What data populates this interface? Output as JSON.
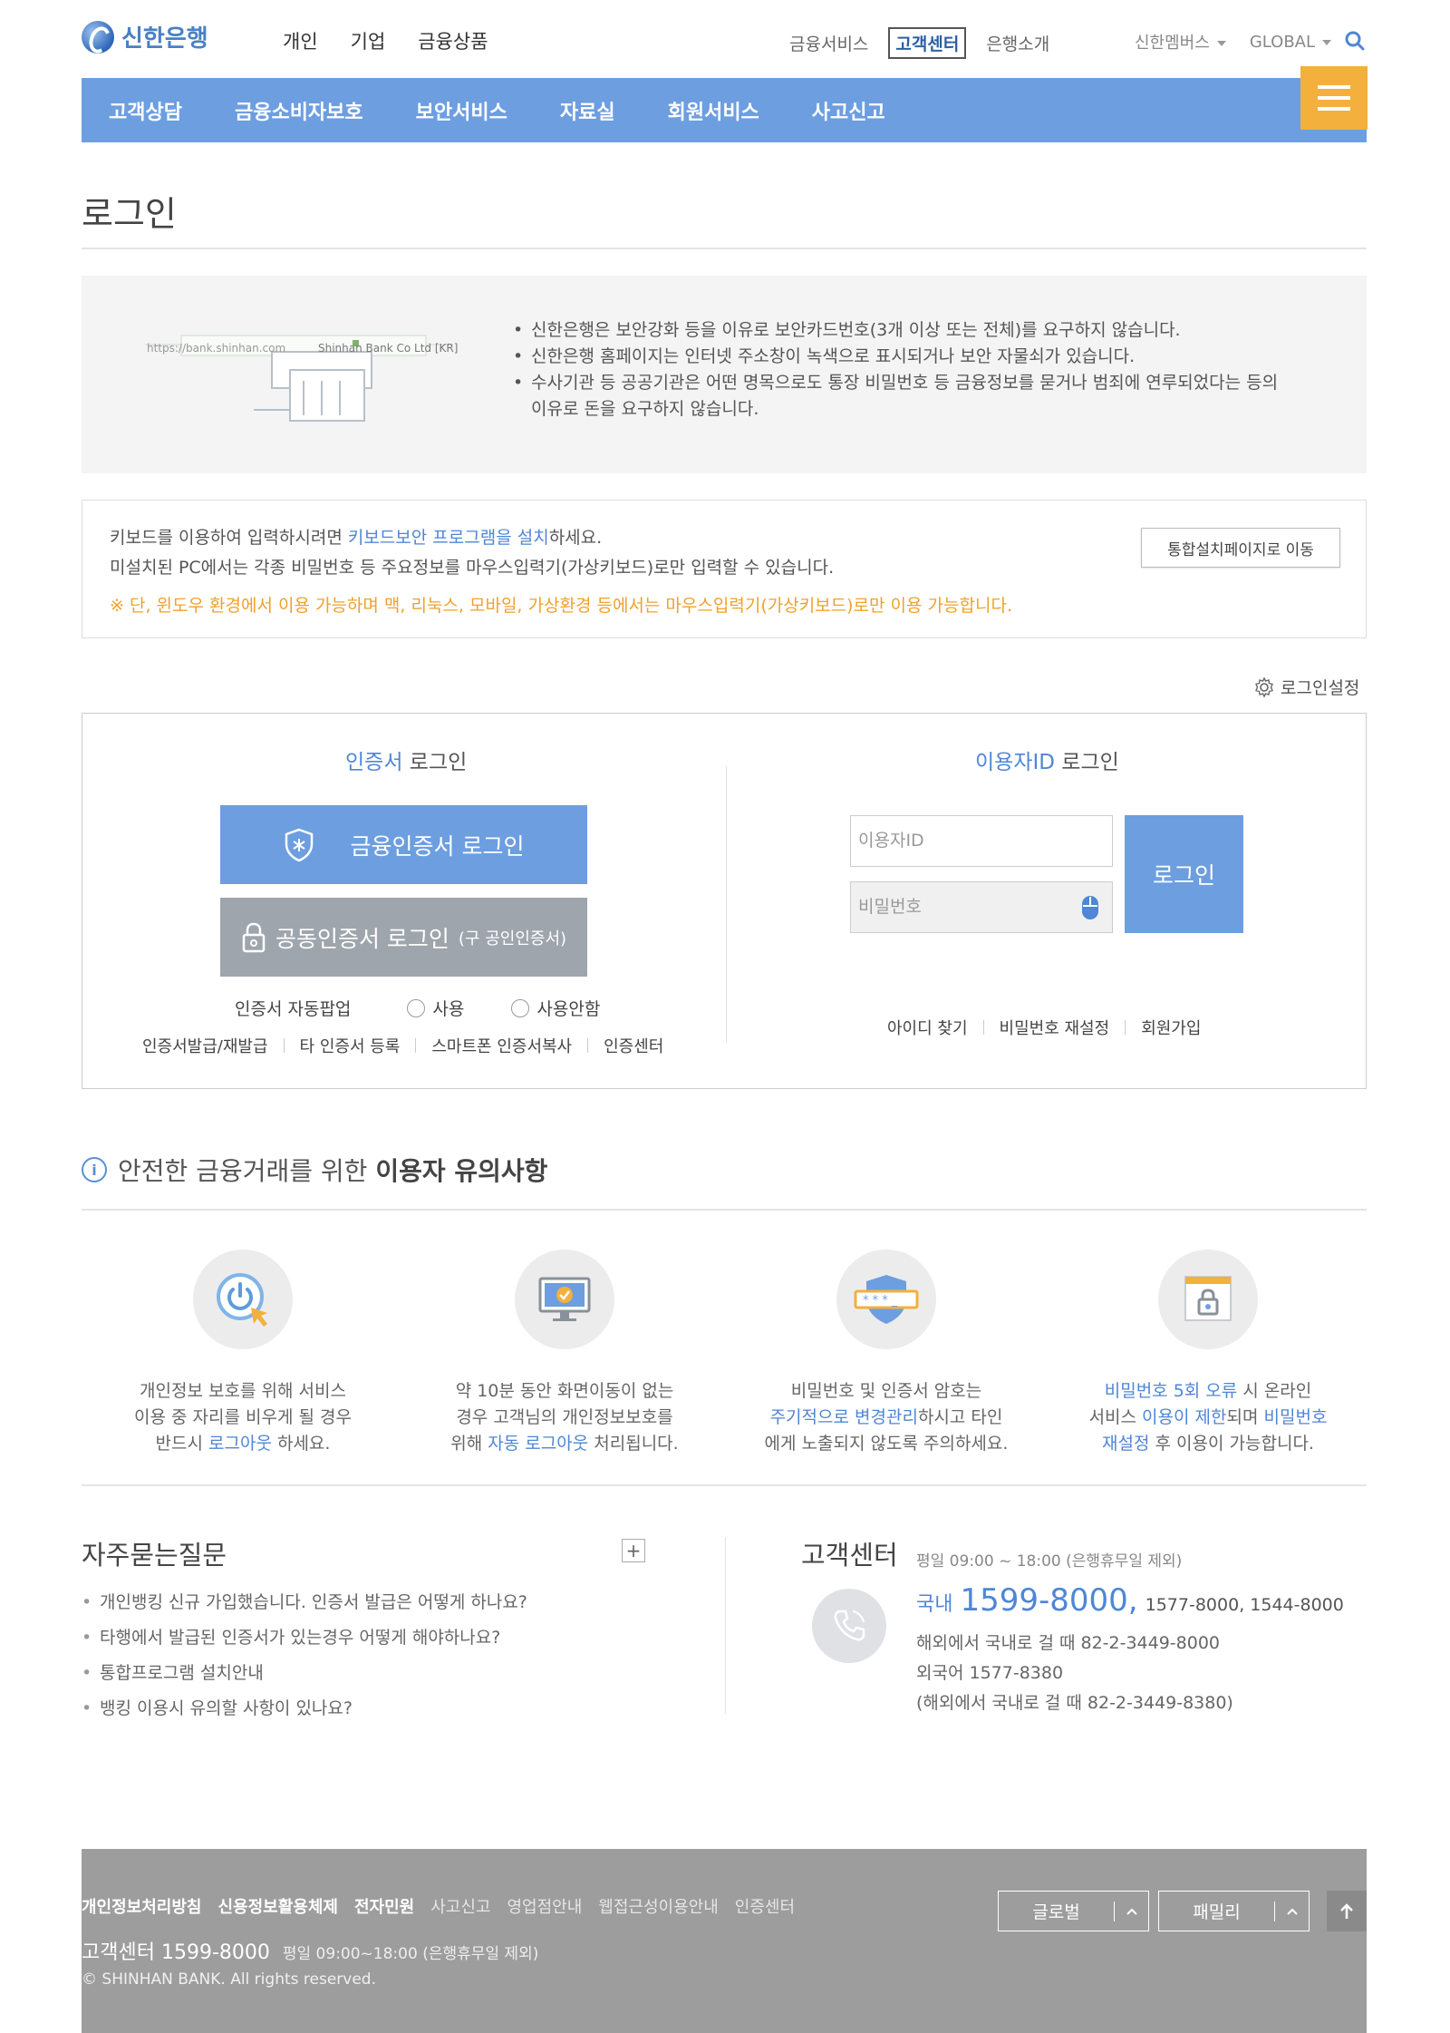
{
  "header": {
    "logo_text": "신한은행",
    "main_nav": [
      "개인",
      "기업",
      "금융상품"
    ],
    "sub_nav": [
      "금융서비스",
      "고객센터",
      "은행소개"
    ],
    "right_nav": [
      "신한멤버스",
      "GLOBAL"
    ]
  },
  "gnb": [
    "고객상담",
    "금융소비자보호",
    "보안서비스",
    "자료실",
    "회원서비스",
    "사고신고"
  ],
  "page_title": "로그인",
  "notice": {
    "url_text": "https://bank.shinhan.com",
    "cert_text": "Shinhan Bank Co Ltd [KR]",
    "items": [
      "신한은행은 보안강화 등을 이유로 보안카드번호(3개 이상 또는 전체)를 요구하지 않습니다.",
      "신한은행 홈페이지는 인터넷 주소창이 녹색으로 표시되거나 보안 자물쇠가 있습니다.",
      "수사기관 등 공공기관은 어떤 명목으로도 통장 비밀번호 등 금융정보를 묻거나 범죄에 연루되었다는 등의",
      "이유로 돈을 요구하지 않습니다."
    ]
  },
  "keyboard": {
    "line1_pre": "키보드를 이용하여 입력하시려면 ",
    "line1_link": "키보드보안 프로그램을 설치",
    "line1_post": "하세요.",
    "line2": "미설치된 PC에서는 각종 비밀번호 등 주요정보를 마우스입력기(가상키보드)로만 입력할 수 있습니다.",
    "line3": "※ 단, 윈도우 환경에서 이용 가능하며 맥, 리눅스, 모바일, 가상환경 등에서는 마우스입력기(가상키보드)로만 이용 가능합니다.",
    "install_button": "통합설치페이지로 이동"
  },
  "login_setting": "로그인설정",
  "cert_login": {
    "title_highlight": "인증서",
    "title_rest": " 로그인",
    "finance_cert_button": "금융인증서 로그인",
    "joint_cert_button": "공동인증서 로그인",
    "joint_cert_sub": "(구 공인인증서)",
    "popup_label": "인증서 자동팝업",
    "popup_use": "사용",
    "popup_not_use": "사용안함",
    "links": [
      "인증서발급/재발급",
      "타 인증서 등록",
      "스마트폰 인증서복사",
      "인증센터"
    ]
  },
  "id_login": {
    "title_highlight": "이용자ID",
    "title_rest": " 로그인",
    "id_placeholder": "이용자ID",
    "pw_placeholder": "비밀번호",
    "login_button": "로그인",
    "links": [
      "아이디 찾기",
      "비밀번호 재설정",
      "회원가입"
    ]
  },
  "safety": {
    "title_pre": "안전한 금융거래를 위한 ",
    "title_bold": "이용자 유의사항",
    "tips": [
      {
        "line1": "개인정보 보호를 위해 서비스",
        "line2": "이용 중 자리를 비우게 될 경우",
        "line3_pre": "반드시 ",
        "line3_hl": "로그아웃",
        "line3_post": " 하세요."
      },
      {
        "line1": "약 10분 동안 화면이동이 없는",
        "line2": "경우 고객님의 개인정보보호를",
        "line3_pre": "위해 ",
        "line3_hl": "자동 로그아웃",
        "line3_post": " 처리됩니다."
      },
      {
        "line1": "비밀번호 및 인증서 암호는",
        "line2_hl": "주기적으로 변경관리",
        "line2_post": "하시고 타인",
        "line3": "에게 노출되지 않도록 주의하세요."
      },
      {
        "line1_hl": "비밀번호 5회 오류",
        "line1_post": " 시 온라인",
        "line2_pre": "서비스 ",
        "line2_hl": "이용이 제한",
        "line2_mid": "되며 ",
        "line2_hl2": "비밀번호",
        "line3_hl": "재설정",
        "line3_post": " 후 이용이 가능합니다."
      }
    ]
  },
  "faq": {
    "title": "자주묻는질문",
    "plus": "+",
    "items": [
      "개인뱅킹 신규 가입했습니다. 인증서 발급은 어떻게 하나요?",
      "타행에서 발급된 인증서가 있는경우 어떻게 해야하나요?",
      "통합프로그램 설치안내",
      "뱅킹 이용시 유의할 사항이 있나요?"
    ]
  },
  "customer_center": {
    "title": "고객센터",
    "hours": "평일 09:00 ~ 18:00 (은행휴무일 제외)",
    "domestic_label": "국내",
    "domestic_number": "1599-8000,",
    "domestic_others": "1577-8000, 1544-8000",
    "overseas": "해외에서 국내로 걸 때 82-2-3449-8000",
    "foreign": "외국어 1577-8380",
    "foreign_overseas": "(해외에서 국내로 걸 때 82-2-3449-8380)"
  },
  "footer": {
    "links_strong": [
      "개인정보처리방침",
      "신용정보활용체제",
      "전자민원"
    ],
    "links_dim": [
      "사고신고",
      "영업점안내",
      "웹접근성이용안내",
      "인증센터"
    ],
    "cc_label": "고객센터 1599-8000",
    "cc_hours": "평일 09:00~18:00 (은행휴무일 제외)",
    "copyright": "© SHINHAN BANK. All rights reserved.",
    "global_select": "글로벌",
    "family_select": "패밀리"
  },
  "colors": {
    "primary_blue": "#6d9ee0",
    "menu_orange": "#f3b03c",
    "warning_orange": "#f0a12a",
    "footer_gray": "#9d9d9d"
  }
}
